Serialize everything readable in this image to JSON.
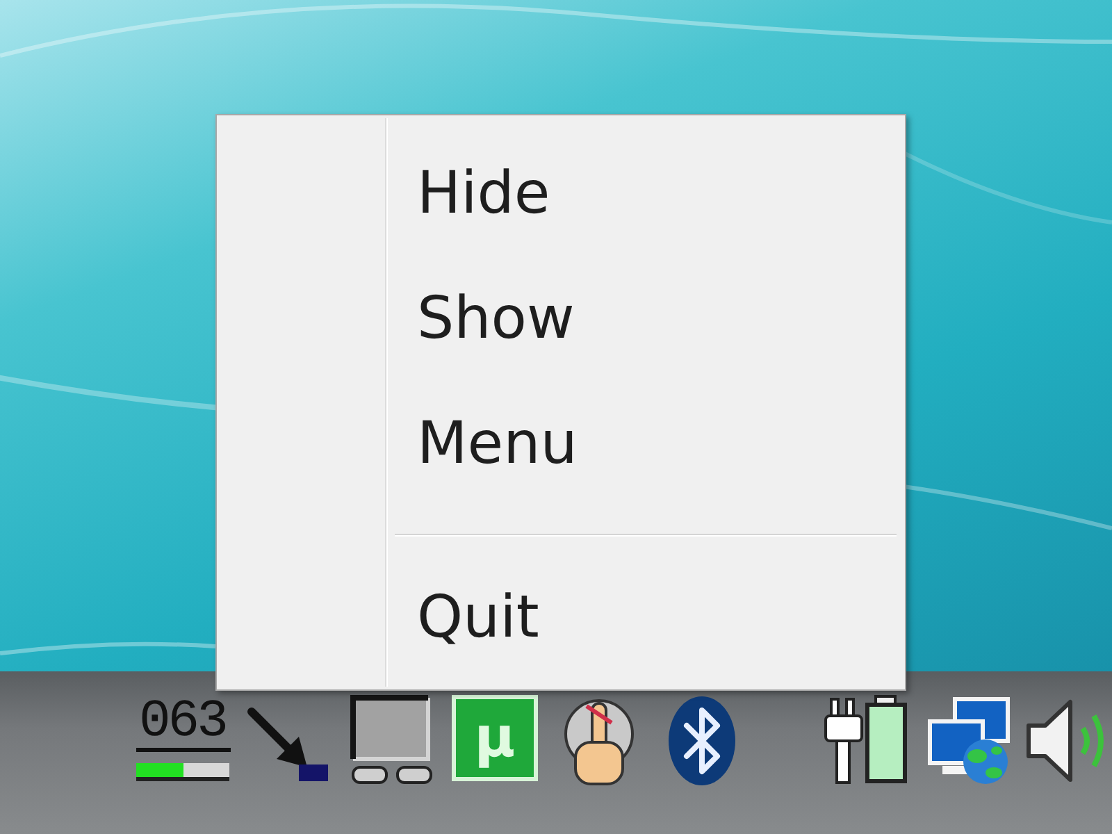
{
  "context_menu": {
    "items": [
      {
        "kind": "item",
        "label": "Hide"
      },
      {
        "kind": "item",
        "label": "Show"
      },
      {
        "kind": "item",
        "label": "Menu"
      },
      {
        "kind": "separator"
      },
      {
        "kind": "item",
        "label": "Quit"
      }
    ]
  },
  "taskbar": {
    "meter": {
      "reading": "063",
      "level": 0.5
    },
    "tile_letter": "µ"
  }
}
